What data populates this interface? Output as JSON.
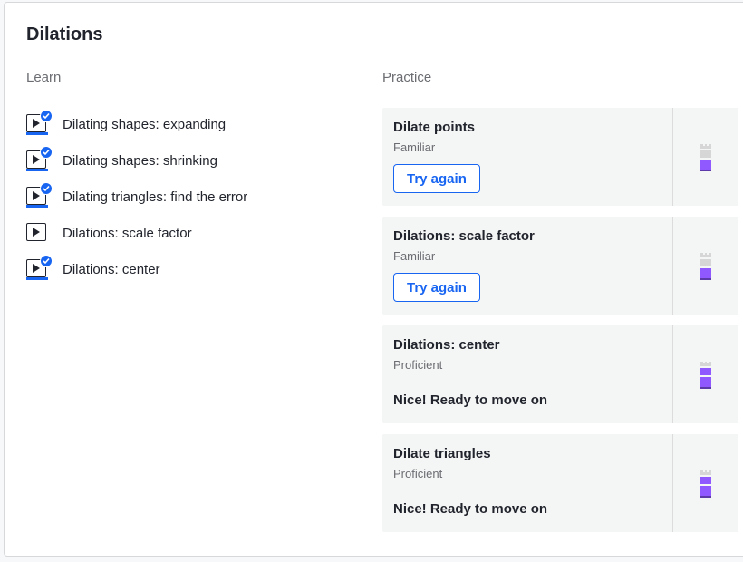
{
  "unit": {
    "title": "Dilations"
  },
  "learn": {
    "label": "Learn",
    "items": [
      {
        "label": "Dilating shapes: expanding",
        "completed": true
      },
      {
        "label": "Dilating shapes: shrinking",
        "completed": true
      },
      {
        "label": "Dilating triangles: find the error",
        "completed": true
      },
      {
        "label": "Dilations: scale factor",
        "completed": false
      },
      {
        "label": "Dilations: center",
        "completed": true
      }
    ]
  },
  "practice": {
    "label": "Practice",
    "items": [
      {
        "title": "Dilate points",
        "level": "Familiar",
        "button": "Try again",
        "message": "",
        "mastery_levels_filled": 1
      },
      {
        "title": "Dilations: scale factor",
        "level": "Familiar",
        "button": "Try again",
        "message": "",
        "mastery_levels_filled": 1
      },
      {
        "title": "Dilations: center",
        "level": "Proficient",
        "button": "",
        "message": "Nice! Ready to move on",
        "mastery_levels_filled": 2
      },
      {
        "title": "Dilate triangles",
        "level": "Proficient",
        "button": "",
        "message": "Nice! Ready to move on",
        "mastery_levels_filled": 2
      }
    ]
  },
  "colors": {
    "accent": "#1865f2",
    "mastery_fill": "#9059ff",
    "mastery_dark": "#5c3aa8",
    "mastery_empty": "#d6d6d6"
  },
  "icons": {
    "video": "video-play-icon",
    "completed": "checkmark-badge-icon",
    "mastery": "mastery-tower-icon"
  }
}
